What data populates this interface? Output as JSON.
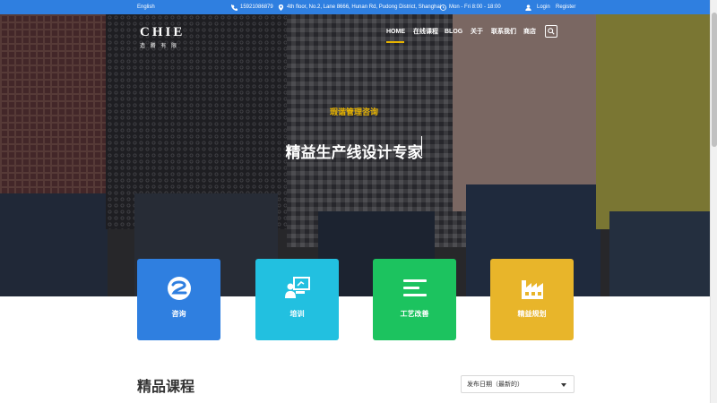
{
  "topbar": {
    "language": "English",
    "phone": "15921086879",
    "address": "4th floor, No.2, Lane 8666, Hunan Rd, Pudong District, Shanghai",
    "hours": "Mon - Fri 8:00 - 18:00",
    "login": "Login",
    "register": "Register",
    "background": "#2f7fe0"
  },
  "logo": {
    "main": "CHIE",
    "sub": "造 腾 有 限"
  },
  "nav": {
    "home": "HOME",
    "courses": "在线课程",
    "blog": "BLOG",
    "about": "关于",
    "contact": "联系我们",
    "shop": "商店",
    "search_icon": "search-icon",
    "active_color": "#e8b400"
  },
  "hero": {
    "subtitle": "瑕谐管理咨询",
    "title": "精益生产线设计专家"
  },
  "cards": [
    {
      "label": "咨询",
      "icon": "consult-icon",
      "color": "#2f7fe0"
    },
    {
      "label": "培训",
      "icon": "training-icon",
      "color": "#22c0e0"
    },
    {
      "label": "工艺改善",
      "icon": "list-icon",
      "color": "#1cc35f"
    },
    {
      "label": "精益规划",
      "icon": "factory-icon",
      "color": "#e8b52a"
    }
  ],
  "courses": {
    "title": "精品课程",
    "sort_value": "发布日期（最新的）"
  }
}
